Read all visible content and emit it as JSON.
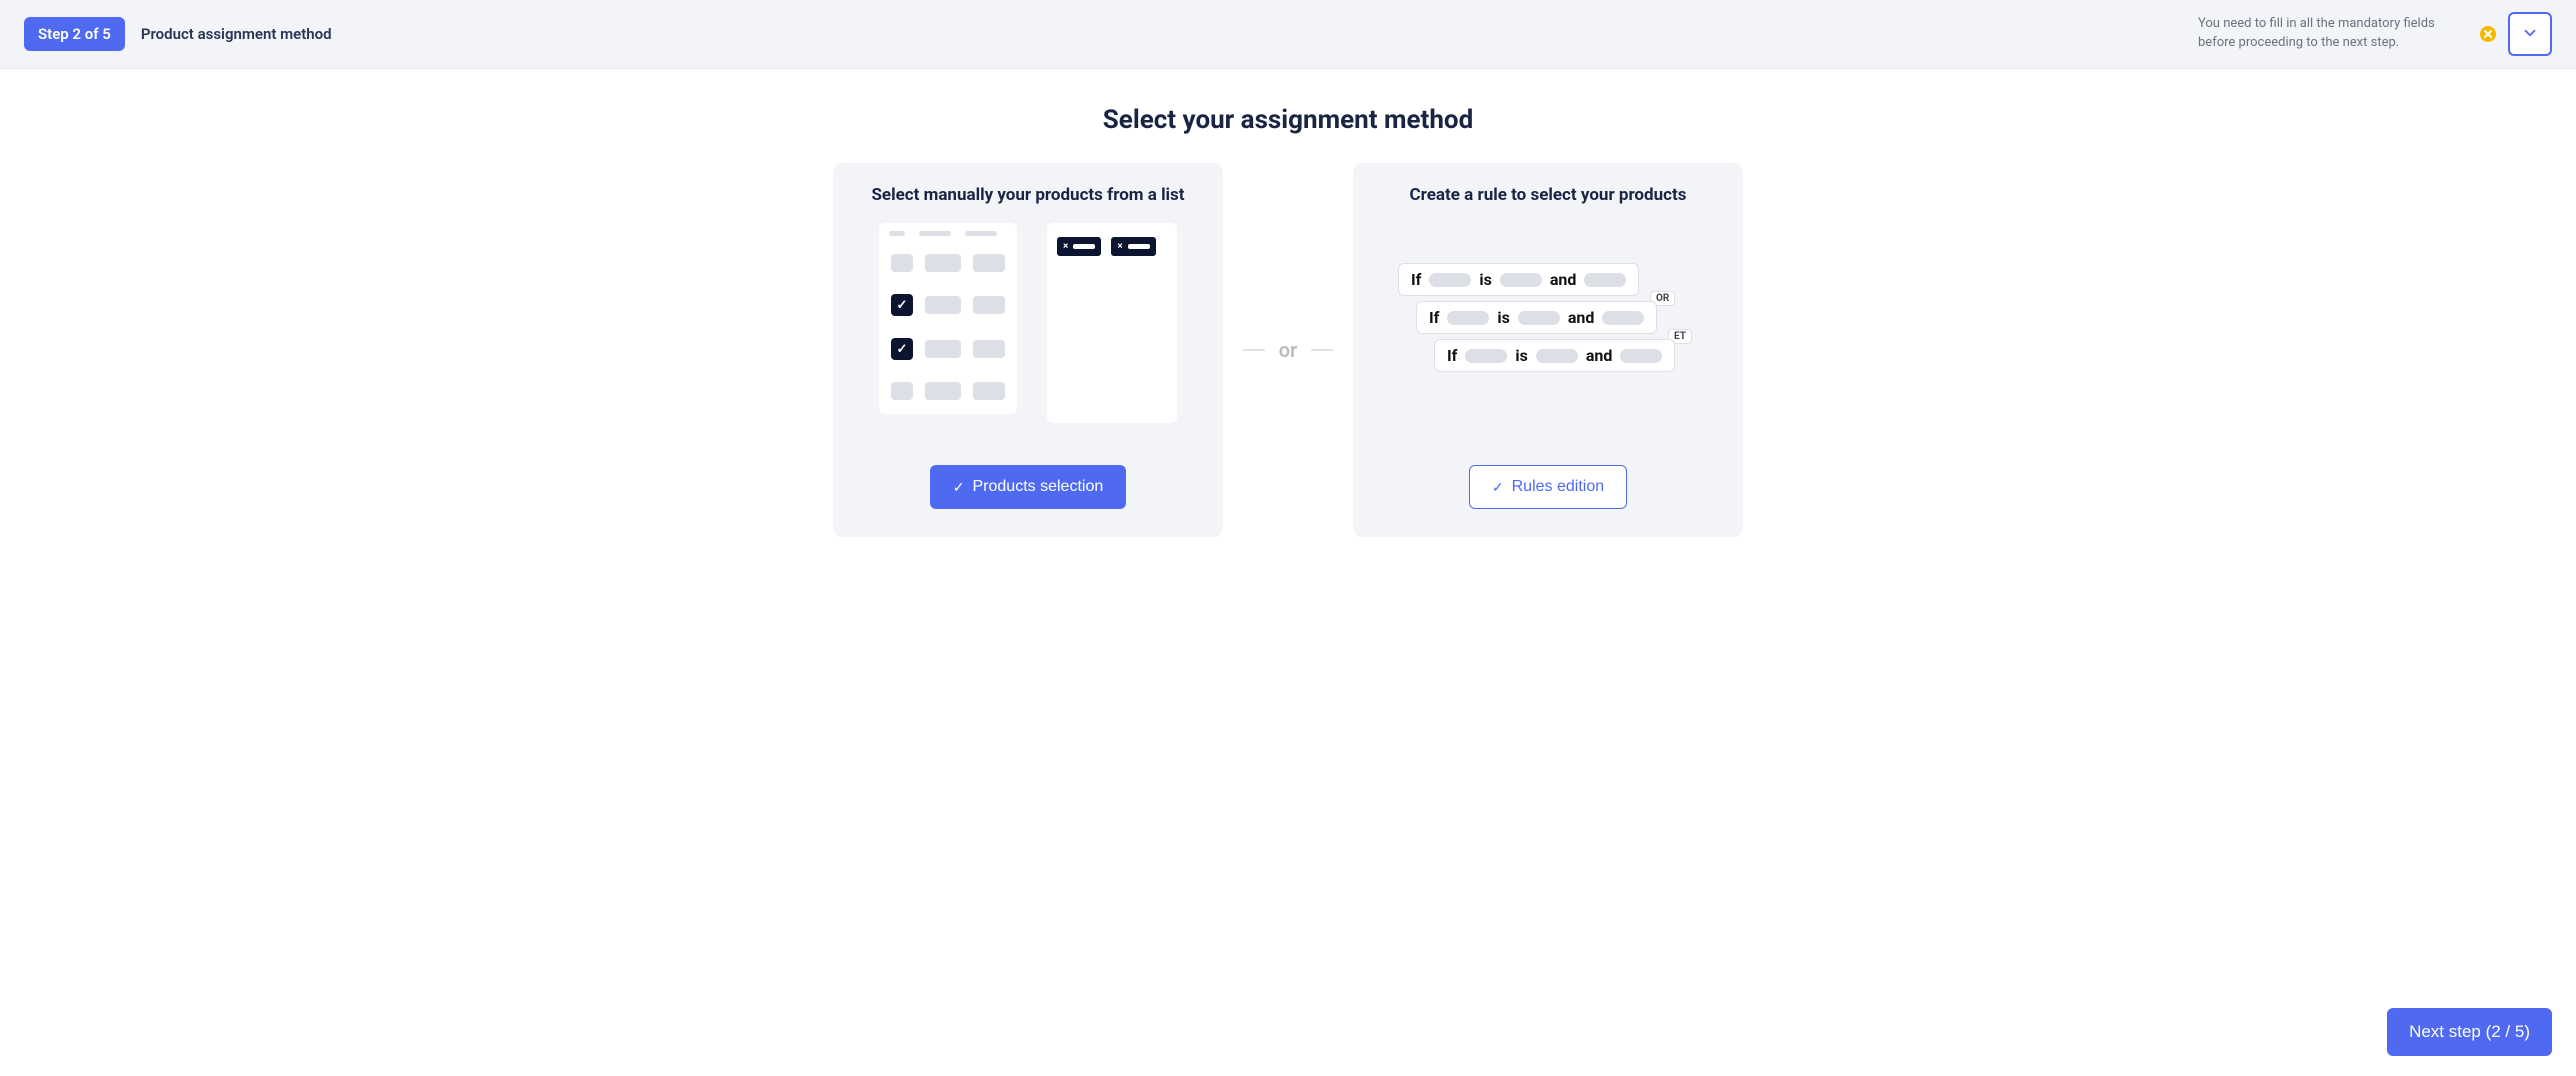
{
  "header": {
    "step_badge": "Step 2 of 5",
    "step_title": "Product assignment method",
    "warning_message": "You need to fill in all the mandatory fields before proceeding to the next step."
  },
  "page": {
    "heading": "Select your assignment method",
    "separator_label": "or"
  },
  "card_left": {
    "title": "Select manually your products from a list",
    "button_label": "Products selection"
  },
  "card_right": {
    "title": "Create a rule to select your products",
    "button_label": "Rules edition",
    "rule_tokens": {
      "if": "If",
      "is": "is",
      "and": "and"
    },
    "badges": {
      "or": "OR",
      "et": "ET"
    }
  },
  "footer": {
    "next_button": "Next step (2 / 5)"
  }
}
